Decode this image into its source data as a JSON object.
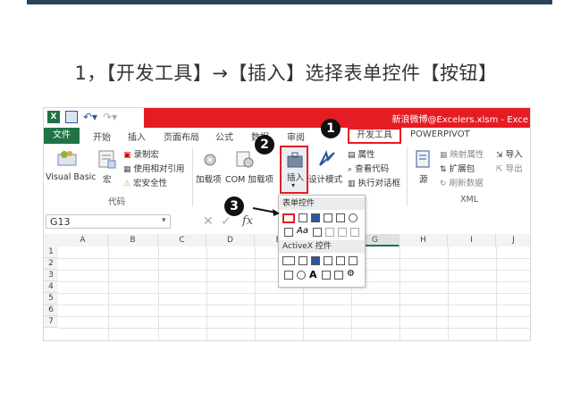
{
  "heading": "1，【开发工具】→【插入】选择表单控件【按钮】",
  "excel": {
    "filename": "新浪微博@Excelers.xlsm - Exce",
    "tabs": [
      "文件",
      "开始",
      "插入",
      "页面布局",
      "公式",
      "数据",
      "审阅",
      "开发工具",
      "POWERPIVOT"
    ],
    "ribbon": {
      "visual_basic": "Visual Basic",
      "macro": "宏",
      "record_macro": "录制宏",
      "relative_ref": "使用相对引用",
      "macro_security": "宏安全性",
      "group_code": "代码",
      "addins": "加载项",
      "com_addins": "COM 加载项",
      "insert": "插入",
      "design_mode": "设计模式",
      "properties": "属性",
      "view_code": "查看代码",
      "run_dialog": "执行对话框",
      "source": "源",
      "map_props": "映射属性",
      "expansion_pack": "扩展包",
      "refresh_data": "刷新数据",
      "import": "导入",
      "export": "导出",
      "group_xml": "XML"
    },
    "name_box": "G13",
    "fx": "fx",
    "columns": [
      "A",
      "B",
      "C",
      "D",
      "E",
      "F",
      "G",
      "H",
      "I",
      "J"
    ],
    "rows": [
      "1",
      "2",
      "3",
      "4",
      "5",
      "6",
      "7"
    ],
    "dropdown": {
      "form_controls": "表单控件",
      "activex_controls": "ActiveX 控件"
    }
  },
  "callouts": [
    "1",
    "2",
    "3"
  ]
}
